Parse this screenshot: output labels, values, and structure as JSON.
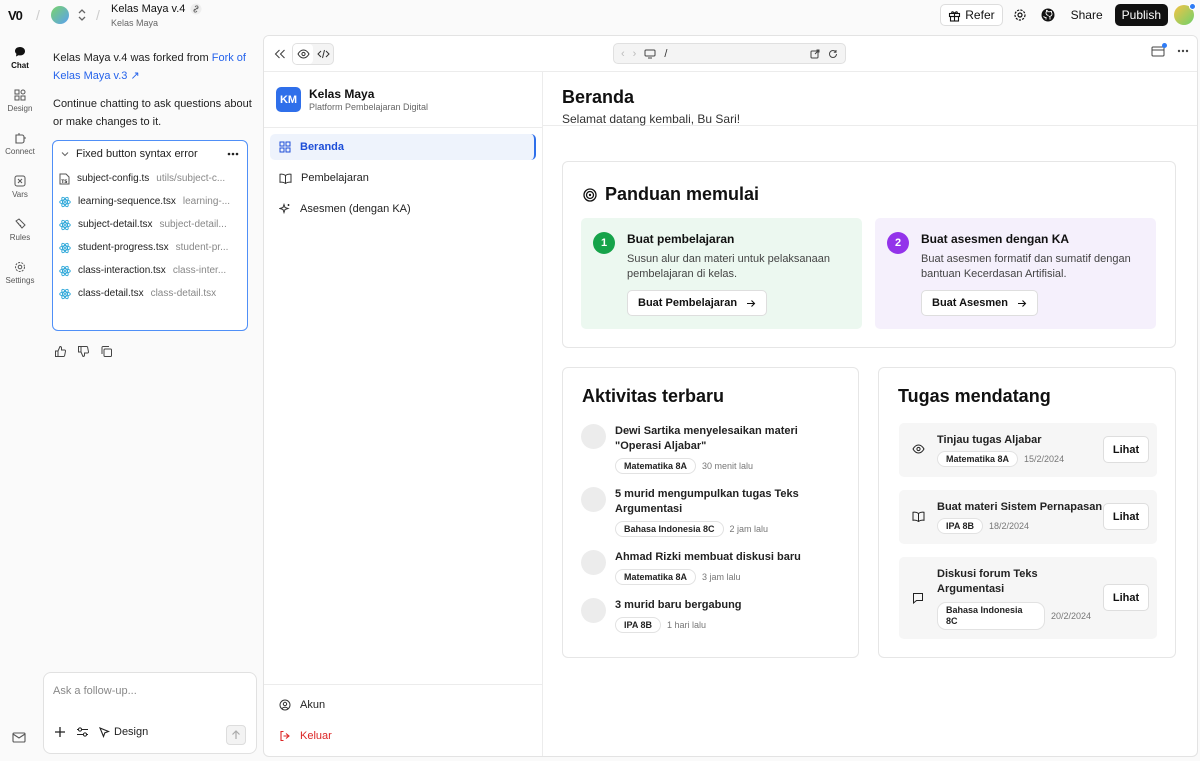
{
  "topbar": {
    "logo": "V0",
    "project_title": "Kelas Maya v.4",
    "project_sub": "Kelas Maya",
    "refer_label": "Refer",
    "share_label": "Share",
    "publish_label": "Publish"
  },
  "rail": {
    "items": [
      {
        "label": "Chat",
        "icon": "chat-icon"
      },
      {
        "label": "Design",
        "icon": "design-icon"
      },
      {
        "label": "Connect",
        "icon": "connect-icon"
      },
      {
        "label": "Vars",
        "icon": "vars-icon"
      },
      {
        "label": "Rules",
        "icon": "rules-icon"
      },
      {
        "label": "Settings",
        "icon": "gear-icon"
      }
    ]
  },
  "chat": {
    "fork_prefix": "Kelas Maya v.4",
    "fork_middle": " was forked from ",
    "fork_link": "Fork of Kelas Maya v.3",
    "continue_text": "Continue chatting to ask questions about or make changes to it.",
    "files_title": "Fixed button syntax error",
    "files": [
      {
        "name": "subject-config.ts",
        "path": "utils/subject-c...",
        "type": "ts"
      },
      {
        "name": "learning-sequence.tsx",
        "path": "learning-...",
        "type": "react"
      },
      {
        "name": "subject-detail.tsx",
        "path": "subject-detail...",
        "type": "react"
      },
      {
        "name": "student-progress.tsx",
        "path": "student-pr...",
        "type": "react"
      },
      {
        "name": "class-interaction.tsx",
        "path": "class-inter...",
        "type": "react"
      },
      {
        "name": "class-detail.tsx",
        "path": "class-detail.tsx",
        "type": "react"
      }
    ],
    "composer_placeholder": "Ask a follow-up...",
    "design_label": "Design"
  },
  "preview": {
    "url_path": "/"
  },
  "app": {
    "brand_badge": "KM",
    "brand_name": "Kelas Maya",
    "brand_sub": "Platform Pembelajaran Digital",
    "nav": [
      {
        "label": "Beranda",
        "active": true
      },
      {
        "label": "Pembelajaran",
        "active": false
      },
      {
        "label": "Asesmen (dengan KA)",
        "active": false
      }
    ],
    "account_label": "Akun",
    "logout_label": "Keluar",
    "page_title": "Beranda",
    "page_sub": "Selamat datang kembali, Bu Sari!",
    "guide": {
      "title": "Panduan memulai",
      "steps": [
        {
          "num": "1",
          "title": "Buat pembelajaran",
          "desc": "Susun alur dan materi untuk pelaksanaan pembelajaran di kelas.",
          "button": "Buat Pembelajaran",
          "bg": "#ecf8f0",
          "accent": "#16a34a"
        },
        {
          "num": "2",
          "title": "Buat asesmen dengan KA",
          "desc": "Buat asesmen formatif dan sumatif dengan bantuan Kecerdasan Artifisial.",
          "button": "Buat Asesmen",
          "bg": "#f5f0fc",
          "accent": "#9333ea"
        }
      ]
    },
    "activity": {
      "title": "Aktivitas terbaru",
      "items": [
        {
          "text": "Dewi Sartika menyelesaikan materi \"Operasi Aljabar\"",
          "tag": "Matematika 8A",
          "time": "30 menit lalu"
        },
        {
          "text": "5 murid mengumpulkan tugas Teks Argumentasi",
          "tag": "Bahasa Indonesia 8C",
          "time": "2 jam lalu"
        },
        {
          "text": "Ahmad Rizki membuat diskusi baru",
          "tag": "Matematika 8A",
          "time": "3 jam lalu"
        },
        {
          "text": "3 murid baru bergabung",
          "tag": "IPA 8B",
          "time": "1 hari lalu"
        }
      ]
    },
    "tasks": {
      "title": "Tugas mendatang",
      "items": [
        {
          "title": "Tinjau tugas Aljabar",
          "tag": "Matematika 8A",
          "date": "15/2/2024",
          "button": "Lihat",
          "icon": "eye-icon"
        },
        {
          "title": "Buat materi Sistem Pernapasan",
          "tag": "IPA 8B",
          "date": "18/2/2024",
          "button": "Lihat",
          "icon": "book-icon"
        },
        {
          "title": "Diskusi forum Teks Argumentasi",
          "tag": "Bahasa Indonesia 8C",
          "date": "20/2/2024",
          "button": "Lihat",
          "icon": "message-icon"
        }
      ]
    }
  }
}
